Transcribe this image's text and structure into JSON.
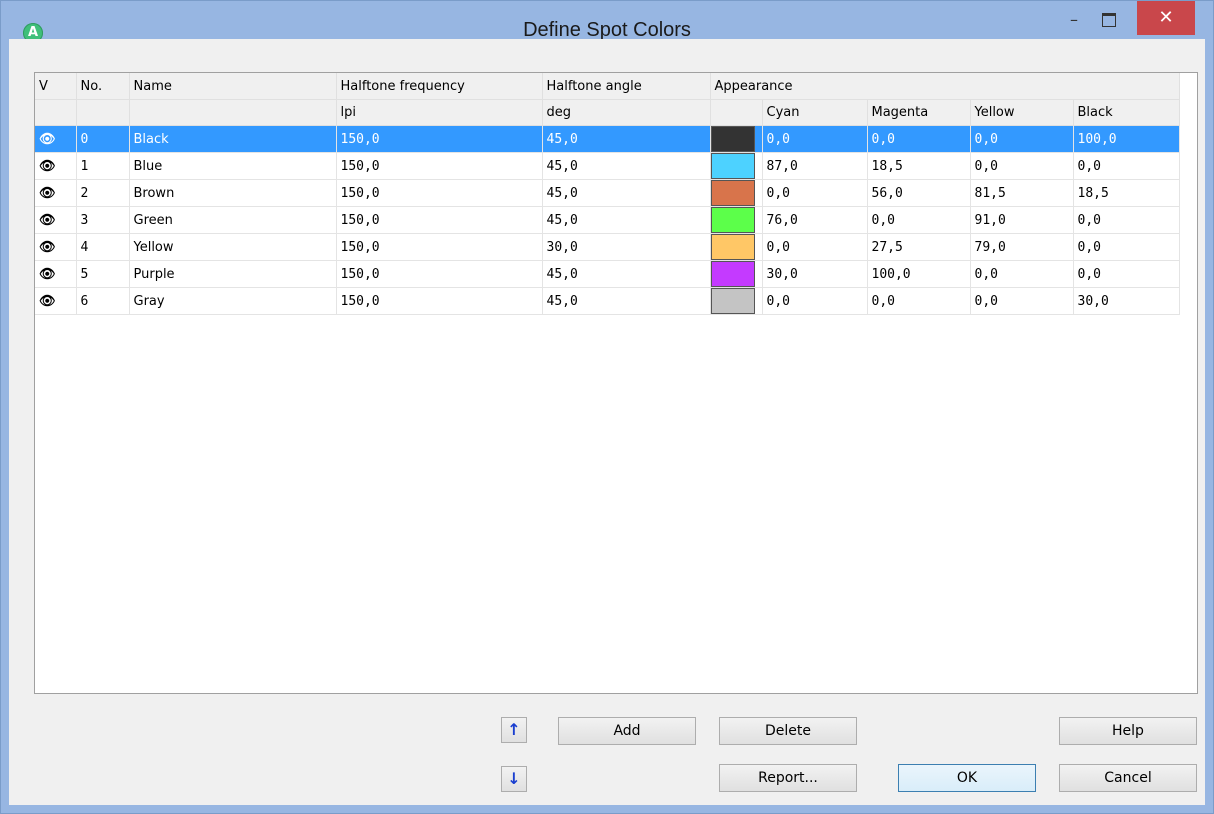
{
  "window": {
    "title": "Define Spot Colors",
    "app_icon_letter": "A",
    "minimize_glyph": "–",
    "close_glyph": "✕"
  },
  "grid": {
    "columns": [
      "V",
      "No.",
      "Name",
      "Halftone frequency",
      "Halftone angle",
      "Appearance"
    ],
    "subheaders": {
      "frequency_unit": "lpi",
      "angle_unit": "deg",
      "cyan": "Cyan",
      "magenta": "Magenta",
      "yellow": "Yellow",
      "black": "Black"
    },
    "visible_icon": "eye-icon",
    "selected_row": 0,
    "rows": [
      {
        "no": "0",
        "name": "Black",
        "freq": "150,0",
        "angle": "45,0",
        "color": "#333333",
        "c": "0,0",
        "m": "0,0",
        "y": "0,0",
        "k": "100,0"
      },
      {
        "no": "1",
        "name": "Blue",
        "freq": "150,0",
        "angle": "45,0",
        "color": "#4dd2ff",
        "c": "87,0",
        "m": "18,5",
        "y": "0,0",
        "k": "0,0"
      },
      {
        "no": "2",
        "name": "Brown",
        "freq": "150,0",
        "angle": "45,0",
        "color": "#d8744b",
        "c": "0,0",
        "m": "56,0",
        "y": "81,5",
        "k": "18,5"
      },
      {
        "no": "3",
        "name": "Green",
        "freq": "150,0",
        "angle": "45,0",
        "color": "#5cff4a",
        "c": "76,0",
        "m": "0,0",
        "y": "91,0",
        "k": "0,0"
      },
      {
        "no": "4",
        "name": "Yellow",
        "freq": "150,0",
        "angle": "30,0",
        "color": "#ffc766",
        "c": "0,0",
        "m": "27,5",
        "y": "79,0",
        "k": "0,0"
      },
      {
        "no": "5",
        "name": "Purple",
        "freq": "150,0",
        "angle": "45,0",
        "color": "#c43aff",
        "c": "30,0",
        "m": "100,0",
        "y": "0,0",
        "k": "0,0"
      },
      {
        "no": "6",
        "name": "Gray",
        "freq": "150,0",
        "angle": "45,0",
        "color": "#c4c4c4",
        "c": "0,0",
        "m": "0,0",
        "y": "0,0",
        "k": "30,0"
      }
    ]
  },
  "buttons": {
    "move_up": "↑",
    "move_down": "↓",
    "add": "Add",
    "delete": "Delete",
    "help": "Help",
    "report": "Report...",
    "ok": "OK",
    "cancel": "Cancel"
  }
}
